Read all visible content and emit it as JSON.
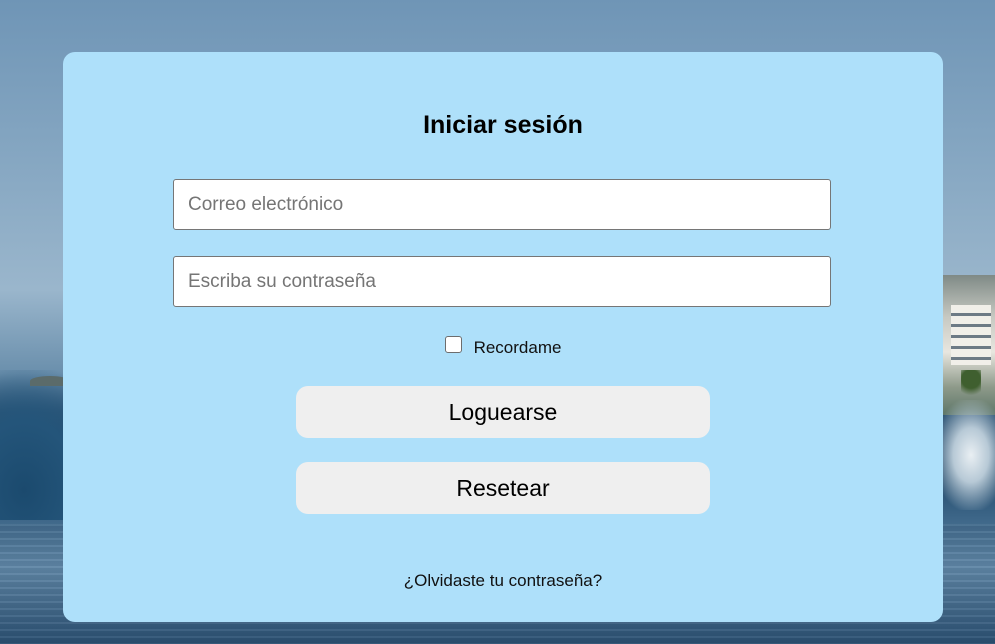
{
  "login": {
    "title": "Iniciar sesión",
    "email_placeholder": "Correo electrónico",
    "email_value": "",
    "password_placeholder": "Escriba su contraseña",
    "password_value": "",
    "remember_label": "Recordame",
    "remember_checked": false,
    "login_button": "Loguearse",
    "reset_button": "Resetear",
    "forgot_link": "¿Olvidaste tu contraseña?"
  },
  "theme": {
    "card_color": "#aee0fa",
    "button_color": "#efefef",
    "background": "ocean-photo"
  }
}
